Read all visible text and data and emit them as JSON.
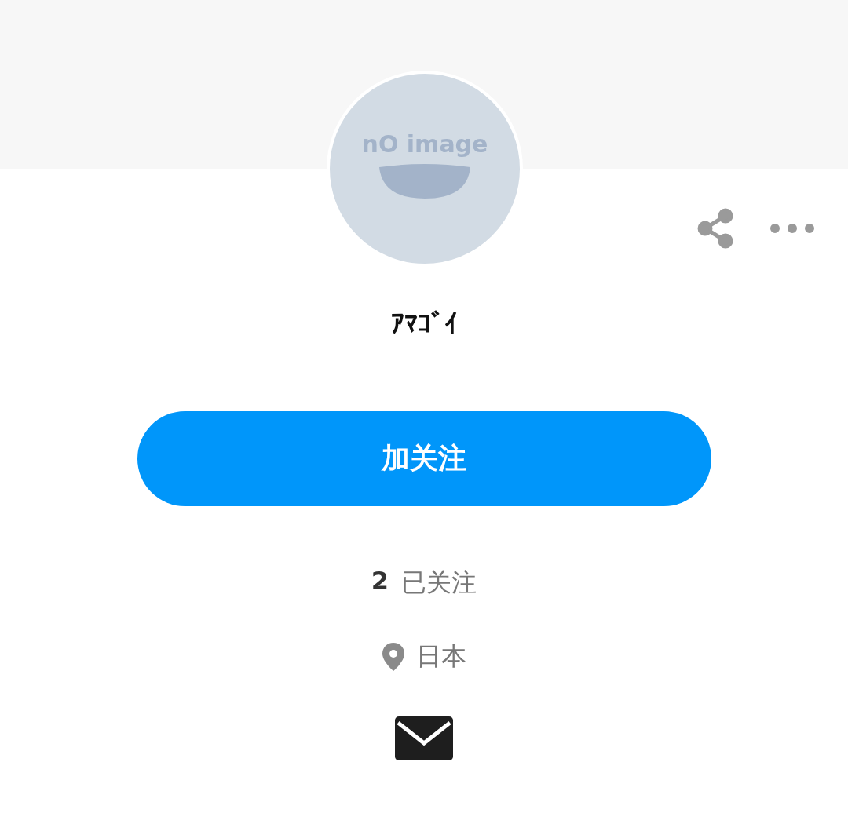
{
  "avatar": {
    "text": "nO image"
  },
  "name": "ｱﾏｺﾞｲ",
  "follow_button": {
    "label": "加关注"
  },
  "following": {
    "count": "2",
    "label": "已关注"
  },
  "location": "日本"
}
